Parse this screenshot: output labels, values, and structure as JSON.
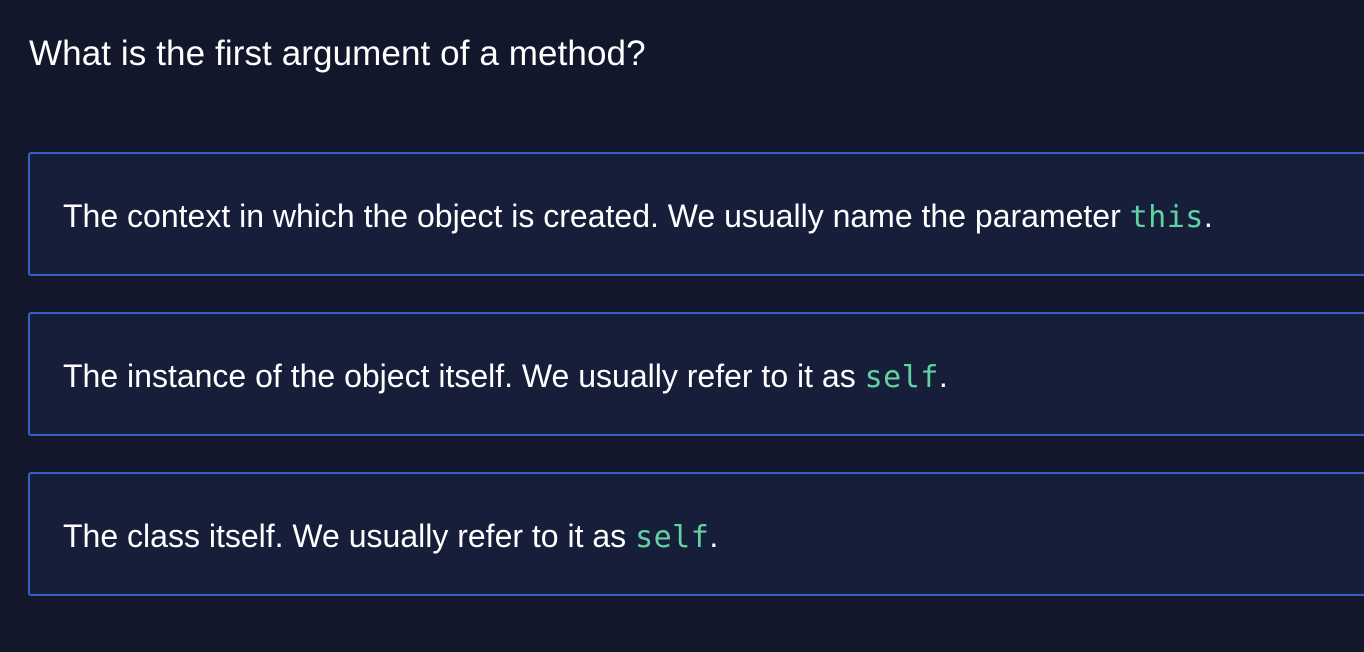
{
  "question": {
    "text": "What is the first argument of a method?"
  },
  "options": [
    {
      "text_before": "The context in which the object is created. We usually name the parameter ",
      "code": "this",
      "text_after": "."
    },
    {
      "text_before": "The instance of the object itself. We usually refer to it as ",
      "code": "self",
      "text_after": "."
    },
    {
      "text_before": "The class itself. We usually refer to it as ",
      "code": "self",
      "text_after": "."
    }
  ],
  "colors": {
    "background": "#12172c",
    "option_background": "#161e3a",
    "option_border": "#3b5ec5",
    "code_text": "#62d2a2",
    "text": "#ffffff"
  }
}
